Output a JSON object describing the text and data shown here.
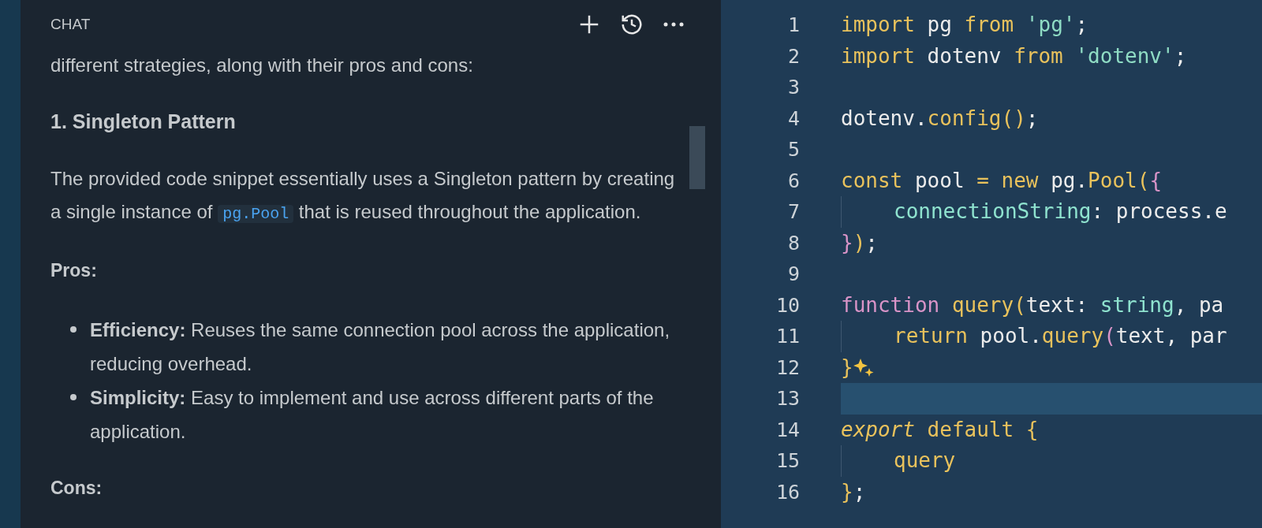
{
  "chat": {
    "title": "CHAT",
    "blocks": [
      {
        "kind": "paragraph",
        "parts": [
          {
            "text": "different strategies, along with their pros and cons:"
          }
        ]
      },
      {
        "kind": "heading",
        "parts": [
          {
            "text": "1. Singleton Pattern"
          }
        ]
      },
      {
        "kind": "paragraph",
        "parts": [
          {
            "text": "The provided code snippet essentially uses a Singleton pattern by creating a single instance of "
          },
          {
            "code": "pg.Pool"
          },
          {
            "text": " that is reused throughout the application."
          }
        ]
      },
      {
        "kind": "label",
        "parts": [
          {
            "text": "Pros:"
          }
        ]
      },
      {
        "kind": "bullets",
        "items": [
          "**Efficiency:** Reuses the same connection pool across the application, reducing overhead.",
          "**Simplicity:** Easy to implement and use across different parts of the application."
        ]
      },
      {
        "kind": "label",
        "parts": [
          {
            "text": "Cons:"
          }
        ]
      }
    ]
  },
  "editor": {
    "lines": [
      {
        "number": "1",
        "tokens": [
          {
            "kind": "kw",
            "text": "import"
          },
          {
            "kind": "plain",
            "text": " pg "
          },
          {
            "kind": "kw",
            "text": "from"
          },
          {
            "kind": "str",
            "text": " 'pg'"
          },
          {
            "kind": "plain",
            "text": ";"
          }
        ]
      },
      {
        "number": "2",
        "tokens": [
          {
            "kind": "kw",
            "text": "import"
          },
          {
            "kind": "plain",
            "text": " dotenv "
          },
          {
            "kind": "kw",
            "text": "from"
          },
          {
            "kind": "str",
            "text": " 'dotenv'"
          },
          {
            "kind": "plain",
            "text": ";"
          }
        ]
      },
      {
        "number": "3"
      },
      {
        "number": "4",
        "tokens": [
          {
            "kind": "plain",
            "text": "dotenv."
          },
          {
            "kind": "fn",
            "text": "config()"
          },
          {
            "kind": "plain",
            "text": ";"
          }
        ]
      },
      {
        "number": "5"
      },
      {
        "number": "6",
        "tokens": [
          {
            "kind": "kw",
            "text": "const"
          },
          {
            "kind": "plain",
            "text": " pool "
          },
          {
            "kind": "kw",
            "text": "= new"
          },
          {
            "kind": "plain",
            "text": " pg."
          },
          {
            "kind": "fn",
            "text": "Pool("
          },
          {
            "kind": "pink",
            "text": "{"
          }
        ]
      },
      {
        "number": "7",
        "indent": true,
        "tokens": [
          {
            "kind": "prop",
            "text": "connectionString"
          },
          {
            "kind": "plain",
            "text": ": process.e"
          }
        ]
      },
      {
        "number": "8",
        "tokens": [
          {
            "kind": "pink",
            "text": "}"
          },
          {
            "kind": "fn",
            "text": ")"
          },
          {
            "kind": "plain",
            "text": ";"
          }
        ]
      },
      {
        "number": "9"
      },
      {
        "number": "10",
        "tokens": [
          {
            "kind": "pink",
            "text": "function"
          },
          {
            "kind": "fn",
            "text": " query("
          },
          {
            "kind": "plain",
            "text": "text: "
          },
          {
            "kind": "prop",
            "text": "string"
          },
          {
            "kind": "plain",
            "text": ", pa"
          }
        ]
      },
      {
        "number": "11",
        "indent": true,
        "tokens": [
          {
            "kind": "kw",
            "text": "return"
          },
          {
            "kind": "plain",
            "text": " pool."
          },
          {
            "kind": "fn",
            "text": "query"
          },
          {
            "kind": "pink",
            "text": "("
          },
          {
            "kind": "plain",
            "text": "text, par"
          }
        ]
      },
      {
        "number": "12",
        "sparkle": true,
        "tokens": [
          {
            "kind": "fn",
            "text": "}"
          }
        ]
      },
      {
        "number": "13",
        "current": true
      },
      {
        "number": "14",
        "tokens": [
          {
            "kind": "kwi",
            "text": "export"
          },
          {
            "kind": "kw",
            "text": " default {"
          }
        ]
      },
      {
        "number": "15",
        "indent": true,
        "tokens": [
          {
            "kind": "kw",
            "text": "query"
          }
        ]
      },
      {
        "number": "16",
        "tokens": [
          {
            "kind": "kw",
            "text": "}"
          },
          {
            "kind": "plain",
            "text": ";"
          }
        ]
      }
    ]
  }
}
